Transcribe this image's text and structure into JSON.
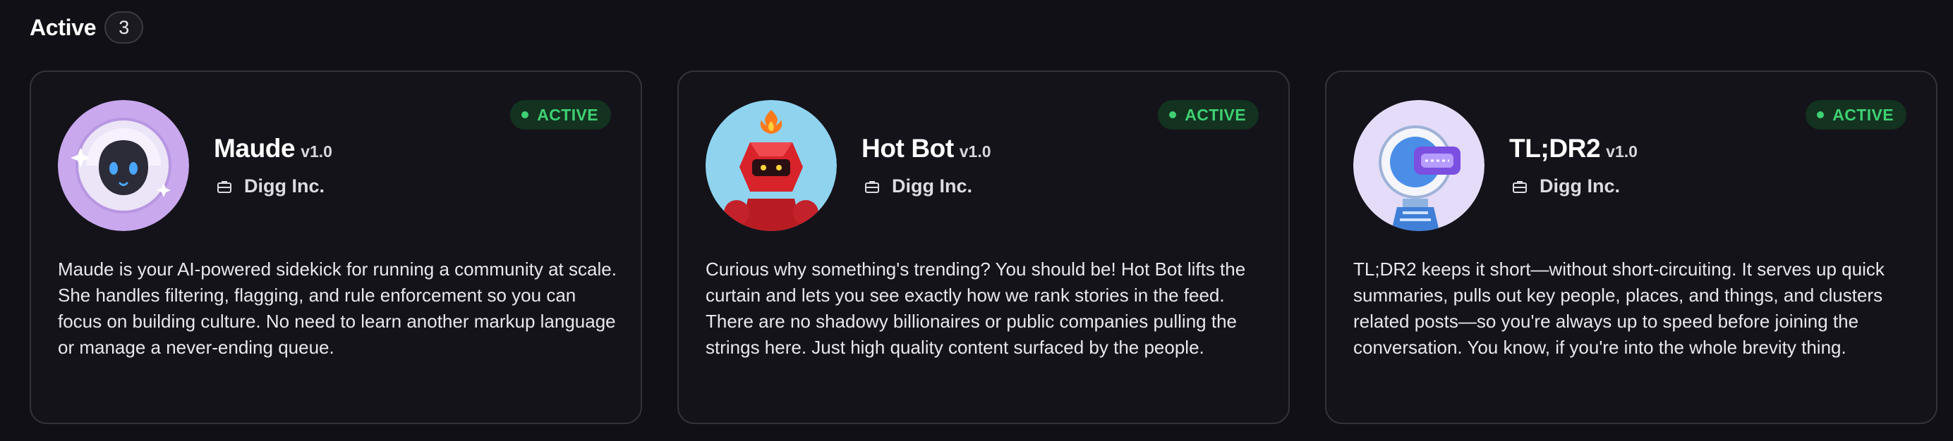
{
  "section": {
    "title": "Active",
    "count": "3"
  },
  "cards": [
    {
      "name": "Maude",
      "version": "v1.0",
      "org": "Digg Inc.",
      "status": "ACTIVE",
      "avatar_icon": "maude-robot-avatar",
      "description": "Maude is your AI-powered sidekick for running a community at scale. She handles filtering, flagging, and rule enforcement so you can focus on building culture. No need to learn another markup language or manage a never-ending queue."
    },
    {
      "name": "Hot Bot",
      "version": "v1.0",
      "org": "Digg Inc.",
      "status": "ACTIVE",
      "avatar_icon": "hot-bot-robot-avatar",
      "description": "Curious why something's trending? You should be! Hot Bot lifts the curtain and lets you see exactly how we rank stories in the feed. There are no shadowy billionaires or public companies pulling the strings here. Just high quality content surfaced by the people."
    },
    {
      "name": "TL;DR2",
      "version": "v1.0",
      "org": "Digg Inc.",
      "status": "ACTIVE",
      "avatar_icon": "tldr2-robot-avatar",
      "description": "TL;DR2 keeps it short—without short-circuiting. It serves up quick summaries, pulls out key people, places, and things, and clusters related posts—so you're always up to speed before joining the conversation. You know, if you're into the whole brevity thing."
    }
  ],
  "colors": {
    "background": "#111016",
    "card_border": "#33323b",
    "active_green": "#3fd073",
    "badge_bg": "#13321f"
  }
}
